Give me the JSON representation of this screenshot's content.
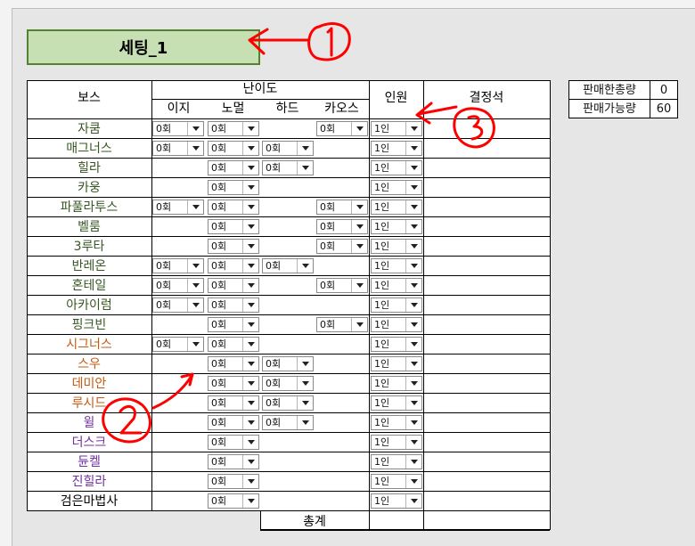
{
  "sheet": {
    "title": "세팅_1",
    "headers": {
      "boss": "보스",
      "difficulty": "난이도",
      "easy": "이지",
      "normal": "노멀",
      "hard": "하드",
      "chaos": "카오스",
      "party": "인원",
      "decision": "결정석"
    },
    "total_label": "총계",
    "stats": [
      {
        "label": "판매한총량",
        "value": "0"
      },
      {
        "label": "판매가능량",
        "value": "60"
      }
    ],
    "annotations": [
      "1",
      "2",
      "3"
    ]
  },
  "colors": {
    "title_fill": "#c6e0b4",
    "title_border": "#548235",
    "boss_green": "#375623",
    "boss_orange": "#c55a11",
    "boss_purple": "#7030a0",
    "boss_black": "#000000",
    "annotation_red": "#ff0000"
  },
  "bosses": [
    {
      "name": "자쿰",
      "color": "#375623",
      "easy": "0회",
      "normal": "0회",
      "hard": null,
      "chaos": "0회",
      "party": "1인"
    },
    {
      "name": "매그너스",
      "color": "#375623",
      "easy": "0회",
      "normal": "0회",
      "hard": "0회",
      "chaos": null,
      "party": "1인"
    },
    {
      "name": "힐라",
      "color": "#375623",
      "easy": null,
      "normal": "0회",
      "hard": "0회",
      "chaos": null,
      "party": "1인"
    },
    {
      "name": "카웅",
      "color": "#375623",
      "easy": null,
      "normal": "0회",
      "hard": null,
      "chaos": null,
      "party": "1인"
    },
    {
      "name": "파풀라투스",
      "color": "#375623",
      "easy": "0회",
      "normal": "0회",
      "hard": null,
      "chaos": "0회",
      "party": "1인"
    },
    {
      "name": "벨룸",
      "color": "#375623",
      "easy": null,
      "normal": "0회",
      "hard": null,
      "chaos": "0회",
      "party": "1인"
    },
    {
      "name": "3루타",
      "color": "#375623",
      "easy": null,
      "normal": "0회",
      "hard": null,
      "chaos": "0회",
      "party": "1인"
    },
    {
      "name": "반레온",
      "color": "#375623",
      "easy": "0회",
      "normal": "0회",
      "hard": "0회",
      "chaos": null,
      "party": "1인"
    },
    {
      "name": "혼테일",
      "color": "#375623",
      "easy": "0회",
      "normal": "0회",
      "hard": null,
      "chaos": "0회",
      "party": "1인"
    },
    {
      "name": "아카이럼",
      "color": "#375623",
      "easy": "0회",
      "normal": "0회",
      "hard": null,
      "chaos": null,
      "party": "1인"
    },
    {
      "name": "핑크빈",
      "color": "#375623",
      "easy": null,
      "normal": "0회",
      "hard": null,
      "chaos": "0회",
      "party": "1인"
    },
    {
      "name": "시그너스",
      "color": "#c55a11",
      "easy": "0회",
      "normal": "0회",
      "hard": null,
      "chaos": null,
      "party": "1인"
    },
    {
      "name": "스우",
      "color": "#c55a11",
      "easy": null,
      "normal": "0회",
      "hard": "0회",
      "chaos": null,
      "party": "1인"
    },
    {
      "name": "데미안",
      "color": "#c55a11",
      "easy": null,
      "normal": "0회",
      "hard": "0회",
      "chaos": null,
      "party": "1인"
    },
    {
      "name": "루시드",
      "color": "#c55a11",
      "easy": null,
      "normal": "0회",
      "hard": "0회",
      "chaos": null,
      "party": "1인"
    },
    {
      "name": "윌",
      "color": "#7030a0",
      "easy": null,
      "normal": "0회",
      "hard": "0회",
      "chaos": null,
      "party": "1인"
    },
    {
      "name": "더스크",
      "color": "#7030a0",
      "easy": null,
      "normal": "0회",
      "hard": null,
      "chaos": null,
      "party": "1인"
    },
    {
      "name": "듄켈",
      "color": "#7030a0",
      "easy": null,
      "normal": "0회",
      "hard": null,
      "chaos": null,
      "party": "1인"
    },
    {
      "name": "진힐라",
      "color": "#7030a0",
      "easy": null,
      "normal": "0회",
      "hard": null,
      "chaos": null,
      "party": "1인"
    },
    {
      "name": "검은마법사",
      "color": "#000000",
      "easy": null,
      "normal": "0회",
      "hard": null,
      "chaos": null,
      "party": "1인"
    }
  ]
}
